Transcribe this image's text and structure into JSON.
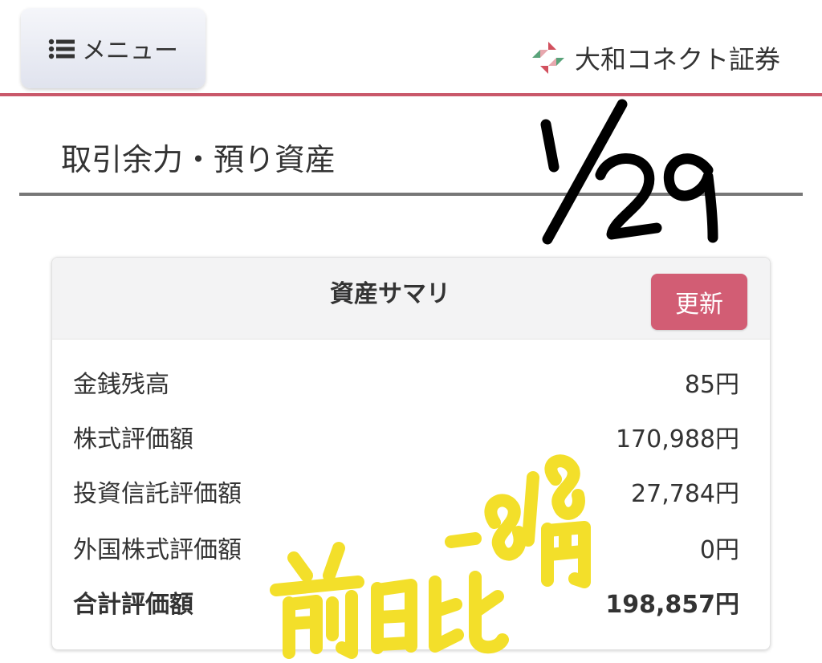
{
  "header": {
    "menu_label": "メニュー",
    "brand_name": "大和コネクト証券",
    "menu_icon": "list-icon",
    "brand_logo": "daiwa-connect-logo",
    "accent_color": "#c9586a"
  },
  "page": {
    "title": "取引余力・預り資産"
  },
  "annotations": {
    "date": "1/29",
    "note": "前日比 -818円",
    "date_color": "#000000",
    "note_color": "#f3df2a"
  },
  "summary": {
    "title": "資産サマリ",
    "refresh_label": "更新",
    "refresh_color": "#d25d74",
    "rows": [
      {
        "label": "金銭残高",
        "value": "85円"
      },
      {
        "label": "株式評価額",
        "value": "170,988円"
      },
      {
        "label": "投資信託評価額",
        "value": "27,784円"
      },
      {
        "label": "外国株式評価額",
        "value": "0円"
      }
    ],
    "total": {
      "label": "合計評価額",
      "value": "198,857円"
    }
  }
}
